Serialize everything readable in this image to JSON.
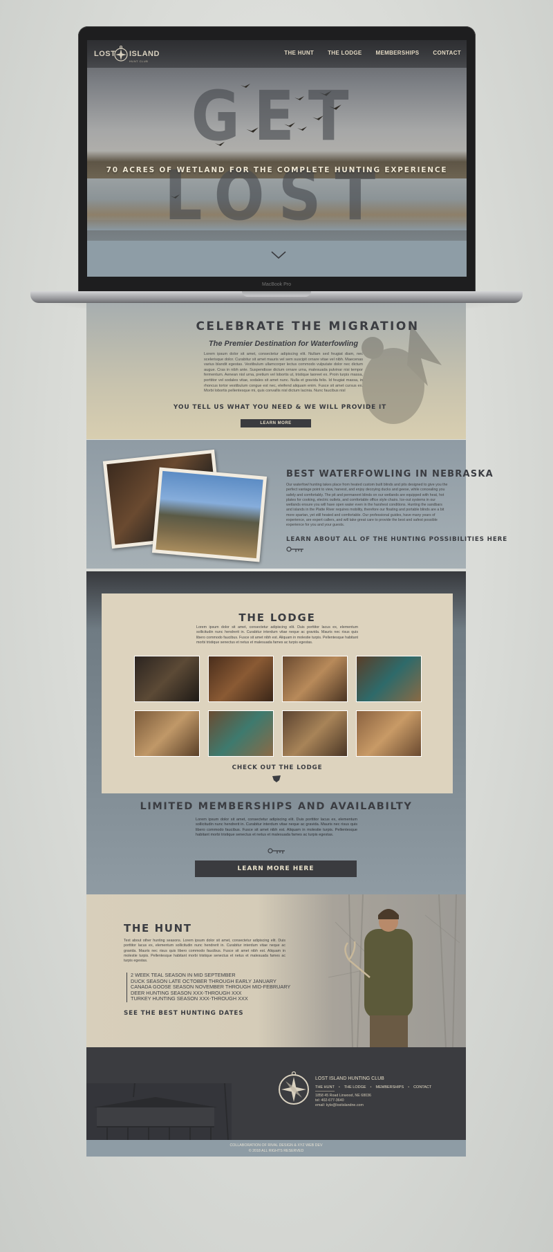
{
  "device": {
    "label": "MacBook Pro"
  },
  "nav": {
    "logo_left": "LOST",
    "logo_right": "ISLAND",
    "logo_sub": "HUNT CLUB",
    "links": [
      "THE HUNT",
      "THE LODGE",
      "MEMBERSHIPS",
      "CONTACT"
    ]
  },
  "hero": {
    "title": "GET LOST",
    "subtitle": "70 ACRES OF WETLAND FOR THE COMPLETE HUNTING EXPERIENCE"
  },
  "migration": {
    "title": "CELEBRATE THE MIGRATION",
    "subtitle": "The Premier Destination for Waterfowling",
    "body": "Lorem ipsum dolor sit amet, consectetur adipiscing elit. Nullam sed feugiat diam, nec scelerisque dolor. Curabitur sit amet mauris vel sem suscipit ornare vitae vel nibh. Maecenas varius blandit egestas. Vestibulum ullamcorper lectus commodo vulputate dolor nec dictum augue. Cras in nibh ante. Suspendisse dictum ornare urna, malesuada pulvinar nisi tempor fermentum. Aenean nisl urna, pretium vel lobortis ut, tristique laoreet ex. Proin turpis massa, porttitor vel sodales vitae, sodales sit amet nunc. Nulla et gravida felis. Id feugiat massa, in rhoncus tortor vestibulum congue est nec, eleifend aliquam enim. Fusce sit amet cursus ex. Morbi lobortis pellentesque mi, quis convallis nisl dictum lacinia. Nunc faucibus nisl",
    "cta": "YOU TELL US WHAT YOU NEED & WE WILL PROVIDE IT",
    "button": "LEARN MORE"
  },
  "waterfowl": {
    "title": "BEST WATERFOWLING IN NEBRASKA",
    "body": "Our waterfowl hunting takes place from heated custom built blinds and pits designed to give you the perfect vantage point to view, harvest, and enjoy decoying ducks and geese, while concealing you safely and comfortably. The pit and permanent blinds on our wetlands are equipped with heat, hot plates for cooking, electric outlets, and comfortable office style chairs. Ice-out systems in our wetlands ensure you will have open water even in the harshest conditions. Hunting the sandbars and islands in the Platte River requires mobility, therefore our floating and portable blinds are a bit more spartan, yet still heated and comfortable. Our professional guides, have many years of experience, are expert callers, and will take great care to provide the best and safest possible experience for you and your guests.",
    "link": "LEARN ABOUT ALL OF THE HUNTING POSSIBILITIES HERE"
  },
  "lodge": {
    "title": "THE LODGE",
    "body": "Lorem ipsum dolor sit amet, consectetur adipiscing elit. Duis porttitor lacus ex, elementum sollicitudin nunc hendrerit in. Curabitur interdum vitae neque ac gravida. Mauris nec risus quis libero commodo faucibus. Fusce sit amet nibh est. Aliquam in molestie turpis. Pellentesque habitant morbi tristique senectus et netus et malesuada fames ac turpis egestas.",
    "cta": "CHECK OUT THE LODGE"
  },
  "membership": {
    "title": "LIMITED MEMBERSHIPS AND AVAILABILTY",
    "body": "Lorem ipsum dolor sit amet, consectetur adipiscing elit. Duis porttitor lacus ex, elementum sollicitudin nunc hendrerit in. Curabitur interdum vitae neque ac gravida. Mauris nec risus quis libero commodo faucibus. Fusce sit amet nibh est. Aliquam in molestie turpis. Pellentesque habitant morbi tristique senectus et netus et malesuada fames ac turpis egestas.",
    "button": "LEARN MORE HERE"
  },
  "hunt": {
    "title": "THE HUNT",
    "body": "Text about other hunting seasons. Lorem ipsum dolor sit amet, consectetur adipiscing elit. Duis porttitor lacus ex, elementum sollicitudin nunc hendrerit in. Curabitur interdum vitae neque ac gravida. Mauris nec risus quis libero commodo faucibus. Fusce sit amet nibh est. Aliquam in molestie turpis. Pellentesque habitant morbi tristique senectus et netus et malesuada fames ac turpis egestas.",
    "seasons": [
      "2 WEEK TEAL SEASON IN MID SEPTEMBER",
      "DUCK SEASON LATE OCTOBER THROUGH EARLY JANUARY",
      "CANADA GOOSE SEASON NOVEMBER THROUGH MID-FEBRUARY",
      "DEER HUNTING SEASON XXX-THROUGH XXX",
      "TURKEY HUNTING SEASON XXX-THROUGH XXX"
    ],
    "cta": "SEE THE BEST HUNTING DATES"
  },
  "footer": {
    "name": "LOST ISLAND HUNTING CLUB",
    "links": [
      "THE HUNT",
      "THE LODGE",
      "MEMBERSHIPS",
      "CONTACT"
    ],
    "address": "1858 45 Road Linwood, NE 68036",
    "phone": "tel: 402-677-3640",
    "email": "email: kyle@lostislandne.com",
    "credit": "COLLABORATION OF RIVAL DESIGN & XYZ WEB DEV",
    "copyright": "© 2018 ALL RIGHTS RESERVED"
  },
  "colors": {
    "dark": "#3b3c40",
    "cream": "#ddd3be",
    "slate": "#8f9ba4"
  }
}
